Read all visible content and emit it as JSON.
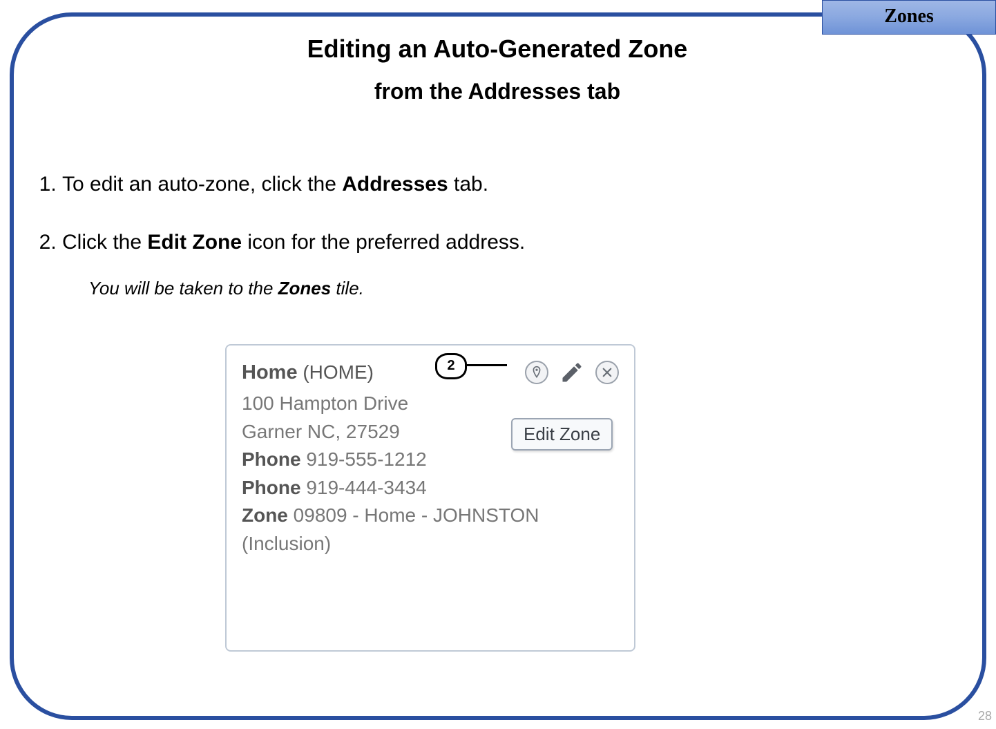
{
  "tabLabel": "Zones",
  "pageNumber": "28",
  "title": {
    "line1": "Editing an Auto-Generated Zone",
    "line2": "from the Addresses tab"
  },
  "steps": {
    "s1_pre": "To edit an auto-zone, click the ",
    "s1_bold": "Addresses",
    "s1_post": " tab.",
    "s2_pre": "Click the ",
    "s2_bold": "Edit Zone",
    "s2_post": " icon for the preferred address."
  },
  "note": {
    "pre": "You will be taken to the ",
    "bold": "Zones",
    "post": " tile."
  },
  "callout": {
    "number": "2"
  },
  "tooltip": {
    "label": "Edit Zone"
  },
  "card": {
    "homeLabel": "Home",
    "homeSub": " (HOME)",
    "addr1": "100 Hampton Drive",
    "addr2": "Garner NC, 27529",
    "phoneLabel1": "Phone",
    "phone1": " 919-555-1212",
    "phoneLabel2": "Phone",
    "phone2": " 919-444-3434",
    "zoneLabel": "Zone",
    "zoneValue": " 09809 - Home - JOHNSTON",
    "zoneNote": "(Inclusion)"
  }
}
